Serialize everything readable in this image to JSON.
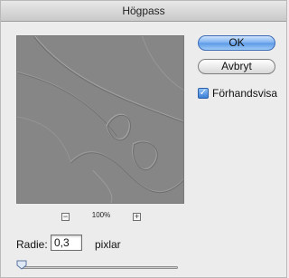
{
  "dialog": {
    "title": "Högpass"
  },
  "preview": {
    "zoom": "100%",
    "zoom_out": "−",
    "zoom_in": "+"
  },
  "buttons": {
    "ok": "OK",
    "cancel": "Avbryt"
  },
  "preview_toggle": {
    "label": "Förhandsvisa",
    "checked": true,
    "check": "✓"
  },
  "radius": {
    "label": "Radie:",
    "value": "0,3",
    "unit": "pixlar",
    "slider_level": 0.0
  },
  "colors": {
    "default_button": "#5b98e6",
    "preview_gray": "#858585"
  }
}
